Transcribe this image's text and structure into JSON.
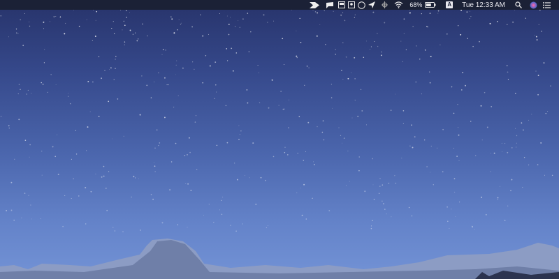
{
  "menubar": {
    "battery_percent": "68%",
    "battery_level": 0.68,
    "input_source": "A",
    "clock": "Tue 12:33 AM"
  },
  "colors": {
    "menubar": "#1b2136",
    "sky_top": "#27336a",
    "sky_bottom": "#7393d6"
  }
}
